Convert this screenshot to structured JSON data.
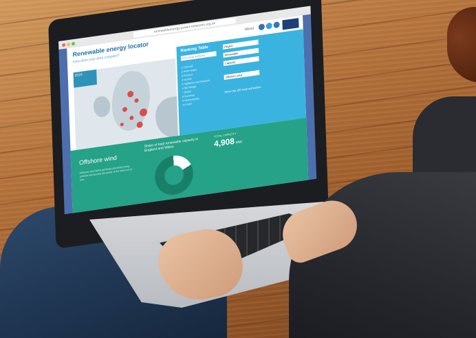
{
  "photo": {
    "description_tag": "laptop-on-lap",
    "colors": {
      "wood": "#b6743d",
      "jeans": "#1e3450",
      "shirt": "#25272c",
      "screen_accent": "#25a287"
    }
  },
  "browser": {
    "url": "renewableenergy.power-networks.org.uk"
  },
  "app": {
    "title": "Renewable energy locator",
    "subtitle": "How does your area compare?",
    "about": "About"
  },
  "map": {
    "tab_label": "2016"
  },
  "ranking": {
    "title": "Ranking Table",
    "input_placeholder": "Find local authority",
    "items": [
      "1  Cornwall",
      "2  North Wales",
      "3  Fenland",
      "4  Norfolk",
      "5  Highlands and Shetland",
      "6  Test Bridge",
      "7  Bristol",
      "8  Somerset",
      "9  Herefordshire",
      "10 Perth"
    ],
    "dropdowns": [
      "Region",
      "Renewable",
      "Capacity",
      "Offshore wind"
    ],
    "note": "Show top 100 local authorities"
  },
  "info": {
    "title": "Offshore wind",
    "text": "Offshore wind farms generate electricity using turbines harnessing the power of the wind out at sea.",
    "share_label": "Share of total renewable capacity in England and Wales",
    "total_label": "TOTAL CAPACITY",
    "total_value": "4,908",
    "total_unit": "MW"
  }
}
